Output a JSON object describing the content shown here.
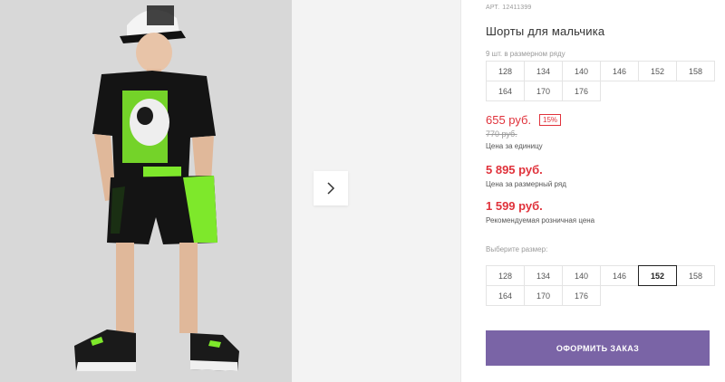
{
  "gallery": {
    "main_photo_alt": "Мальчик в футболке и шортах",
    "next_button_icon": "chevron-right-icon"
  },
  "product": {
    "article_label": "АРТ.",
    "article_number": "12411399",
    "title": "Шорты для мальчика",
    "pack_label": "9 шт. в размерном ряду",
    "pack_sizes": [
      "128",
      "134",
      "140",
      "146",
      "152",
      "158",
      "164",
      "170",
      "176"
    ],
    "price_unit": "655 руб.",
    "discount": "15%",
    "price_old": "770 руб.",
    "price_unit_label": "Цена за единицу",
    "price_pack": "5 895 руб.",
    "price_pack_label": "Цена за размерный ряд",
    "price_retail": "1 599 руб.",
    "price_retail_label": "Рекомендуемая розничная цена",
    "choose_size_label": "Выберите размер:",
    "select_sizes": [
      "128",
      "134",
      "140",
      "146",
      "152",
      "158",
      "164",
      "170",
      "176"
    ],
    "selected_size": "152",
    "order_button": "ОФОРМИТЬ ЗАКАЗ"
  },
  "colors": {
    "accent_red": "#e0323b",
    "button_purple": "#7a64a6",
    "shorts_green": "#7ee82b"
  }
}
